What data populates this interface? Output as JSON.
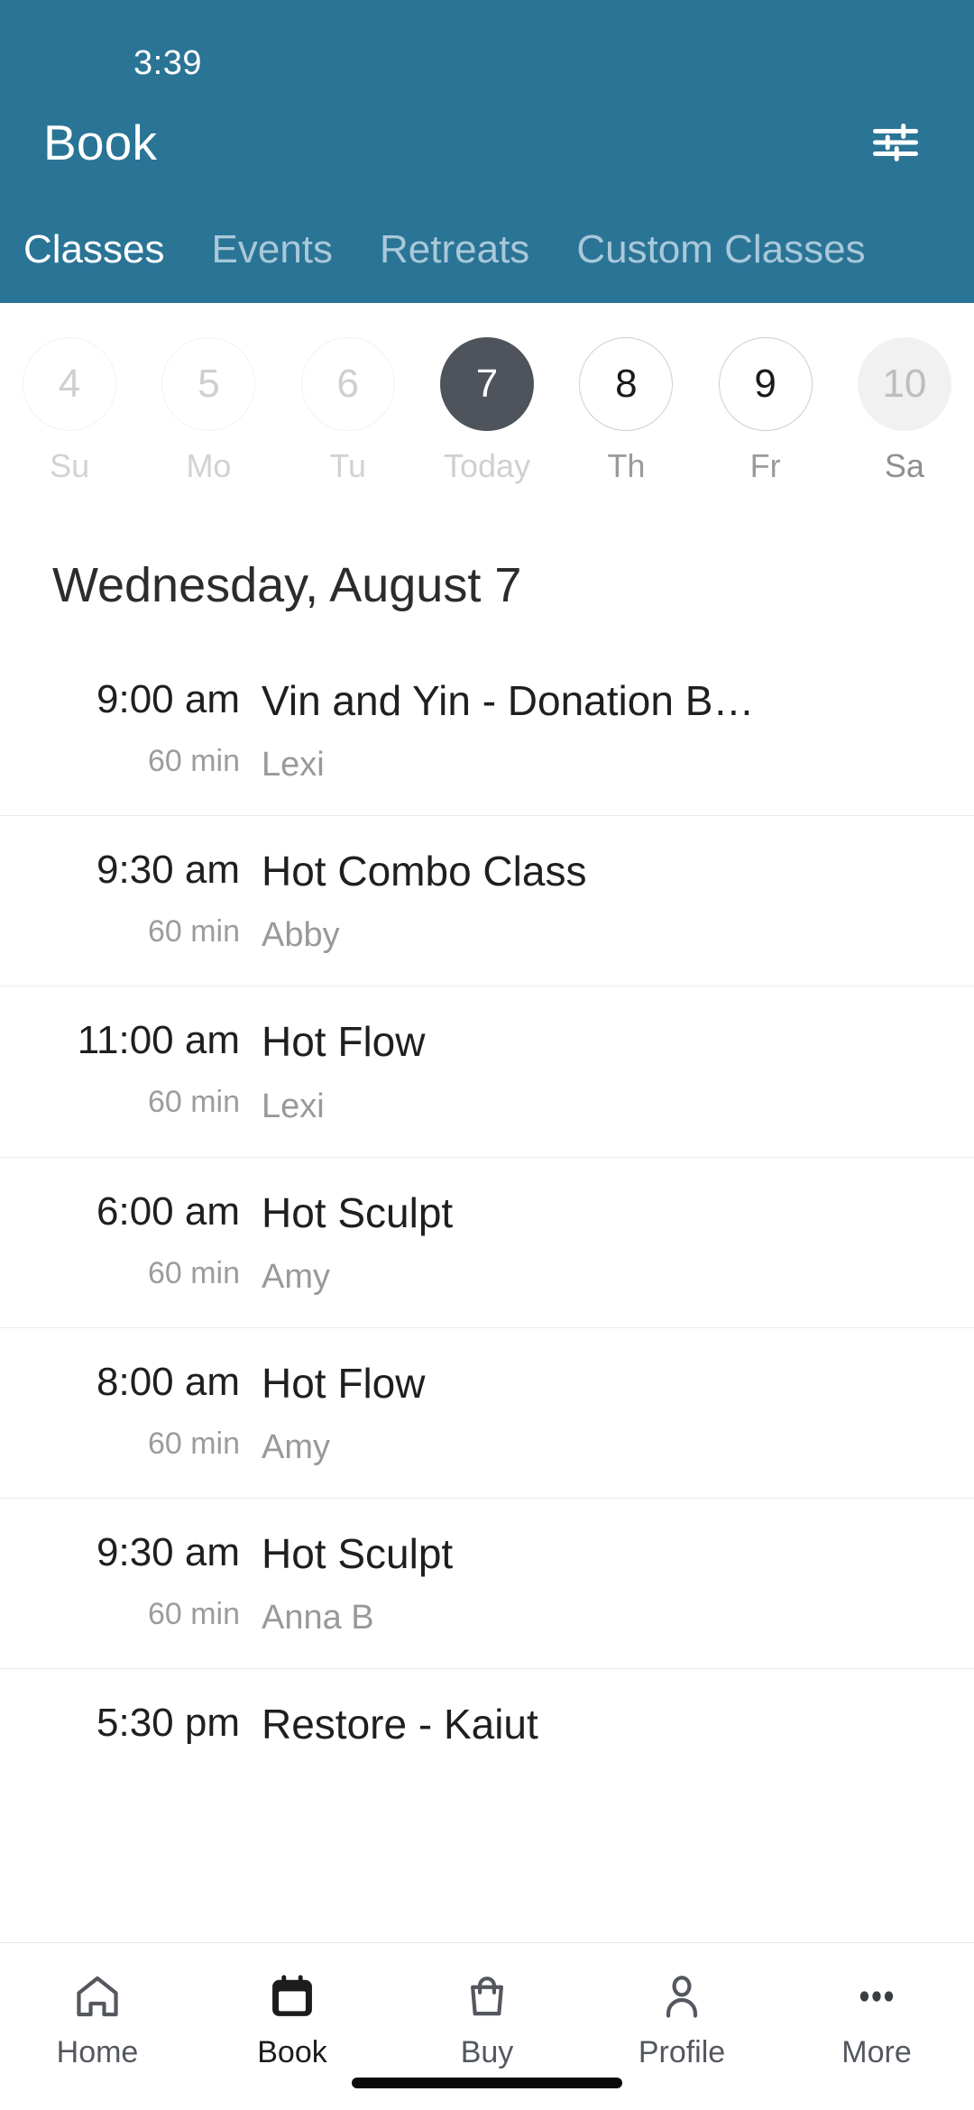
{
  "theme": {
    "header_blue": "#2a7496",
    "selected_day": "#4f535c",
    "muted_text": "#999999",
    "primary_text": "#1f1f1f"
  },
  "status_bar": {
    "clock": "3:39"
  },
  "app_bar": {
    "title": "Book",
    "filter_icon": "tune-icon"
  },
  "tabs": [
    {
      "label": "Classes",
      "active": true
    },
    {
      "label": "Events",
      "active": false
    },
    {
      "label": "Retreats",
      "active": false
    },
    {
      "label": "Custom Classes",
      "active": false
    }
  ],
  "date_strip": [
    {
      "day": "4",
      "weekday": "Su",
      "state": "past"
    },
    {
      "day": "5",
      "weekday": "Mo",
      "state": "past"
    },
    {
      "day": "6",
      "weekday": "Tu",
      "state": "past"
    },
    {
      "day": "7",
      "weekday": "Today",
      "state": "selected"
    },
    {
      "day": "8",
      "weekday": "Th",
      "state": "available"
    },
    {
      "day": "9",
      "weekday": "Fr",
      "state": "available"
    },
    {
      "day": "10",
      "weekday": "Sa",
      "state": "filled"
    }
  ],
  "date_heading": "Wednesday, August 7",
  "classes": [
    {
      "time": "9:00 am",
      "duration": "60 min",
      "name": "Vin and Yin - Donation B…",
      "instructor": "Lexi"
    },
    {
      "time": "9:30 am",
      "duration": "60 min",
      "name": "Hot Combo Class",
      "instructor": "Abby"
    },
    {
      "time": "11:00 am",
      "duration": "60 min",
      "name": "Hot Flow",
      "instructor": "Lexi"
    },
    {
      "time": "6:00 am",
      "duration": "60 min",
      "name": "Hot Sculpt",
      "instructor": "Amy"
    },
    {
      "time": "8:00 am",
      "duration": "60 min",
      "name": "Hot Flow",
      "instructor": "Amy"
    },
    {
      "time": "9:30 am",
      "duration": "60 min",
      "name": "Hot Sculpt",
      "instructor": "Anna B"
    },
    {
      "time": "5:30 pm",
      "duration": "",
      "name": "Restore - Kaiut",
      "instructor": ""
    }
  ],
  "bottom_nav": [
    {
      "label": "Home",
      "icon": "home-icon",
      "active": false
    },
    {
      "label": "Book",
      "icon": "calendar-icon",
      "active": true
    },
    {
      "label": "Buy",
      "icon": "bag-icon",
      "active": false
    },
    {
      "label": "Profile",
      "icon": "person-icon",
      "active": false
    },
    {
      "label": "More",
      "icon": "ellipsis-icon",
      "active": false
    }
  ]
}
